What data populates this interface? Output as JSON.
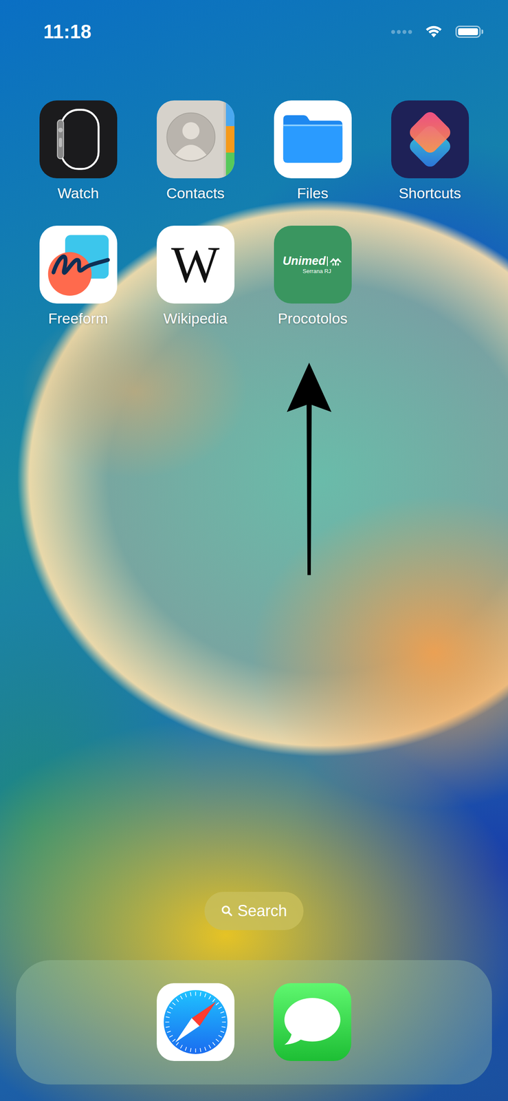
{
  "status_bar": {
    "time": "11:18",
    "cellular_bars": 0,
    "wifi": true,
    "battery_level": 1.0
  },
  "apps": [
    {
      "label": "Watch",
      "kind": "watch"
    },
    {
      "label": "Contacts",
      "kind": "contacts"
    },
    {
      "label": "Files",
      "kind": "files"
    },
    {
      "label": "Shortcuts",
      "kind": "shortcuts"
    },
    {
      "label": "Freeform",
      "kind": "freeform"
    },
    {
      "label": "Wikipedia",
      "kind": "wikipedia",
      "icon_text": [
        "W"
      ]
    },
    {
      "label": "Procotolos",
      "kind": "unimed",
      "icon_text": [
        "Unimed",
        "Serrana RJ"
      ]
    }
  ],
  "search": {
    "label": "Search"
  },
  "dock": [
    {
      "kind": "safari"
    },
    {
      "kind": "messages"
    }
  ],
  "annotation_arrow": true
}
